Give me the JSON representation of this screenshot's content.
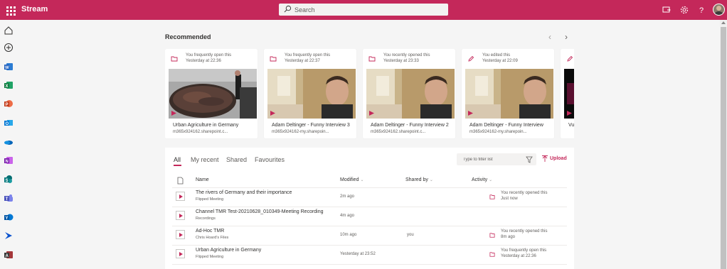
{
  "app": {
    "title": "Stream"
  },
  "search": {
    "placeholder": "Search"
  },
  "colors": {
    "brand": "#c4285a"
  },
  "recommended": {
    "title": "Recommended",
    "cards": [
      {
        "reason": "You frequently open this",
        "time": "Yesterday at 22:36",
        "title": "Urban Agriculture in Germany",
        "url": "m365x924162.sharepoint.c...",
        "icon": "folder-icon"
      },
      {
        "reason": "You frequently open this",
        "time": "Yesterday at 22:37",
        "title": "Adam Deltinger - Funny Interview 3",
        "url": "m365x924162-my.sharepoin...",
        "icon": "folder-icon"
      },
      {
        "reason": "You recently opened this",
        "time": "Yesterday at 23:33",
        "title": "Adam Deltinger - Funny Interview 2",
        "url": "m365x924162.sharepoint.c...",
        "icon": "folder-icon"
      },
      {
        "reason": "You edited this",
        "time": "Yesterday at 22:09",
        "title": "Adam Deltinger - Funny Interview",
        "url": "m365x924162-my.sharepoin...",
        "icon": "pencil-icon"
      },
      {
        "title": "Vu",
        "icon": "pencil-icon"
      }
    ]
  },
  "tabs": [
    "All",
    "My recent",
    "Shared",
    "Favourites"
  ],
  "filter": {
    "placeholder": "Type to filter list"
  },
  "upload": {
    "label": "Upload"
  },
  "columns": {
    "name": "Name",
    "modified": "Modified",
    "shared_by": "Shared by",
    "activity": "Activity"
  },
  "files": [
    {
      "name": "The rivers of Germany and their importance",
      "location": "Flipped Meeting",
      "modified": "2m ago",
      "shared_by": "",
      "activity1": "You recently opened this",
      "activity2": "Just now"
    },
    {
      "name": "Channel TMR Test-20210628_010349-Meeting Recording",
      "location": "Recordings",
      "modified": "4m ago",
      "shared_by": "",
      "activity1": "",
      "activity2": ""
    },
    {
      "name": "Ad-Hoc TMR",
      "location": "Chris Hoard's Files",
      "modified": "10m ago",
      "shared_by": "you",
      "activity1": "You recently opened this",
      "activity2": "8m ago"
    },
    {
      "name": "Urban Agriculture in Germany",
      "location": "Flipped Meeting",
      "modified": "Yesterday at 23:52",
      "shared_by": "",
      "activity1": "You frequently open this",
      "activity2": "Yesterday at 22:36"
    }
  ]
}
